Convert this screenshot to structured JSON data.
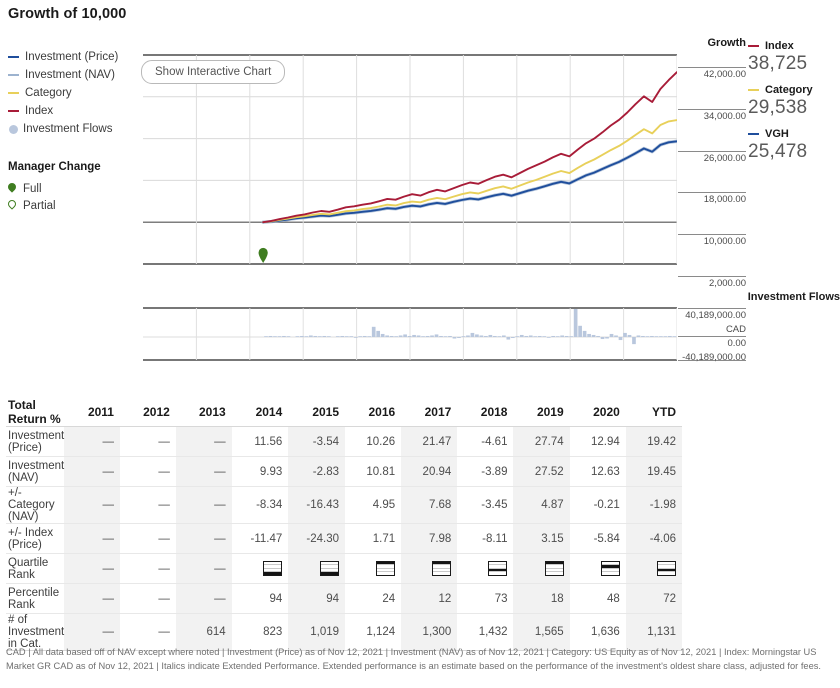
{
  "header": {
    "title": "Growth of 10,000"
  },
  "legend": {
    "items": [
      {
        "label": "Investment (Price)",
        "color": "#1f4e9c",
        "marker": "line"
      },
      {
        "label": "Investment (NAV)",
        "color": "#9db3cf",
        "marker": "line"
      },
      {
        "label": "Category",
        "color": "#e8d05a",
        "marker": "line"
      },
      {
        "label": "Index",
        "color": "#a81c38",
        "marker": "line"
      },
      {
        "label": "Investment Flows",
        "color": "#b9c7dd",
        "marker": "dot"
      }
    ],
    "manager_change": {
      "title": "Manager Change",
      "items": [
        {
          "label": "Full",
          "type": "full",
          "color": "#3f7d20"
        },
        {
          "label": "Partial",
          "type": "partial",
          "color": "#3f7d20"
        }
      ]
    }
  },
  "chart_controls": {
    "show_interactive_label": "Show Interactive Chart"
  },
  "readouts": [
    {
      "name": "Index",
      "value": "38,725",
      "color": "#a81c38"
    },
    {
      "name": "Category",
      "value": "29,538",
      "color": "#e8d05a"
    },
    {
      "name": "VGH",
      "value": "25,478",
      "color": "#1f4e9c"
    }
  ],
  "flows_axis": {
    "title": "Investment Flows",
    "ticks": [
      "40,189,000.00",
      "CAD",
      "0.00",
      "-40,189,000.00"
    ]
  },
  "table": {
    "title": "Total Return %",
    "columns": [
      "2011",
      "2012",
      "2013",
      "2014",
      "2015",
      "2016",
      "2017",
      "2018",
      "2019",
      "2020",
      "YTD"
    ],
    "shaded_columns": [
      0,
      2,
      4,
      6,
      8,
      10
    ],
    "rows": [
      {
        "label": "Investment (Price)",
        "type": "text",
        "values": [
          "—",
          "—",
          "—",
          "11.56",
          "-3.54",
          "10.26",
          "21.47",
          "-4.61",
          "27.74",
          "12.94",
          "19.42"
        ]
      },
      {
        "label": "Investment (NAV)",
        "type": "text",
        "values": [
          "—",
          "—",
          "—",
          "9.93",
          "-2.83",
          "10.81",
          "20.94",
          "-3.89",
          "27.52",
          "12.63",
          "19.45"
        ]
      },
      {
        "label": "+/- Category (NAV)",
        "type": "text",
        "values": [
          "—",
          "—",
          "—",
          "-8.34",
          "-16.43",
          "4.95",
          "7.68",
          "-3.45",
          "4.87",
          "-0.21",
          "-1.98"
        ]
      },
      {
        "label": "+/- Index (Price)",
        "type": "text",
        "values": [
          "—",
          "—",
          "—",
          "-11.47",
          "-24.30",
          "1.71",
          "7.98",
          "-8.11",
          "3.15",
          "-5.84",
          "-4.06"
        ]
      },
      {
        "label": "Quartile Rank",
        "type": "quartile",
        "values": [
          "—",
          "—",
          "—",
          4,
          4,
          1,
          1,
          3,
          1,
          2,
          3
        ]
      },
      {
        "label": "Percentile Rank",
        "type": "text",
        "values": [
          "—",
          "—",
          "—",
          "94",
          "94",
          "24",
          "12",
          "73",
          "18",
          "48",
          "72"
        ]
      },
      {
        "label": "# of Investment in Cat.",
        "type": "text",
        "values": [
          "—",
          "—",
          "614",
          "823",
          "1,019",
          "1,124",
          "1,300",
          "1,432",
          "1,565",
          "1,636",
          "1,131"
        ]
      }
    ]
  },
  "footnote": {
    "text": "CAD | All data based off of NAV except where noted | Investment (Price) as of Nov 12, 2021 | Investment (NAV) as of Nov 12, 2021 | Category: US Equity as of Nov 12, 2021 | Index: Morningstar US Market GR CAD as of Nov 12, 2021 | Italics indicate Extended Performance. Extended performance is an estimate based on the performance of the investment's oldest share class, adjusted for fees."
  },
  "chart_data": {
    "type": "line",
    "title": "Growth of 10,000",
    "ylabel": "Growth",
    "xlabel": "",
    "ylim": [
      2000,
      42000
    ],
    "yticks": [
      42000,
      34000,
      26000,
      18000,
      10000,
      2000
    ],
    "ytick_labels": [
      "42,000.00",
      "34,000.00",
      "26,000.00",
      "18,000.00",
      "10,000.00",
      "2,000.00"
    ],
    "grid": true,
    "legend_position": "left",
    "x": [
      "2011",
      "2012",
      "2013",
      "2014",
      "2015",
      "2016",
      "2017",
      "2018",
      "2019",
      "2020",
      "2021"
    ],
    "series": [
      {
        "name": "Index",
        "color": "#a81c38",
        "final_value": 38725,
        "values": [
          null,
          null,
          10000,
          11300,
          11900,
          13300,
          15800,
          15400,
          19000,
          23600,
          38725
        ],
        "monthly": [
          10000,
          10250,
          10600,
          10900,
          11250,
          11500,
          11850,
          12150,
          12000,
          12400,
          12850,
          13050,
          13350,
          13600,
          14000,
          14450,
          14300,
          14900,
          15350,
          15100,
          15750,
          16200,
          15900,
          16500,
          17100,
          17600,
          17350,
          18050,
          18700,
          19100,
          18600,
          19400,
          20200,
          20900,
          21600,
          22400,
          23100,
          22600,
          23900,
          25100,
          26000,
          27200,
          28500,
          29600,
          31000,
          32600,
          34100,
          33000,
          35500,
          37200,
          38725
        ]
      },
      {
        "name": "Category",
        "color": "#e8d05a",
        "final_value": 29538,
        "values": [
          null,
          null,
          10000,
          11000,
          11400,
          12400,
          14100,
          13600,
          16200,
          19400,
          29538
        ],
        "monthly": [
          10000,
          10180,
          10450,
          10700,
          10950,
          11150,
          11400,
          11600,
          11500,
          11800,
          12100,
          12250,
          12500,
          12700,
          13000,
          13350,
          13200,
          13650,
          13950,
          13800,
          14300,
          14650,
          14400,
          14900,
          15350,
          15700,
          15500,
          16000,
          16500,
          16850,
          16400,
          17000,
          17600,
          18100,
          18700,
          19300,
          19800,
          19400,
          20400,
          21300,
          22000,
          22900,
          23800,
          24600,
          25600,
          26700,
          27800,
          27000,
          28600,
          29300,
          29538
        ]
      },
      {
        "name": "VGH",
        "color": "#1f4e9c",
        "final_value": 25478,
        "values": [
          null,
          null,
          10000,
          10700,
          10900,
          11700,
          13200,
          12700,
          15000,
          17500,
          25478
        ],
        "monthly": [
          10000,
          10120,
          10330,
          10520,
          10740,
          10900,
          11100,
          11270,
          11180,
          11420,
          11680,
          11800,
          12000,
          12160,
          12400,
          12680,
          12560,
          12920,
          13150,
          13030,
          13430,
          13700,
          13500,
          13900,
          14250,
          14520,
          14360,
          14760,
          15150,
          15430,
          15080,
          15550,
          16020,
          16420,
          16880,
          17340,
          17740,
          17420,
          18220,
          18950,
          19500,
          20200,
          20900,
          21550,
          22350,
          23200,
          24100,
          23500,
          24800,
          25300,
          25478
        ]
      }
    ],
    "manager_change_markers": [
      {
        "type": "full",
        "x_fraction": 0.225
      }
    ]
  },
  "flows_chart_data": {
    "type": "bar",
    "title": "Investment Flows",
    "ylim": [
      -40189000,
      40189000
    ],
    "yticks": [
      40189000,
      0,
      -40189000
    ],
    "ytick_labels": [
      "40,189,000.00",
      "0.00",
      "-40,189,000.00"
    ],
    "currency": "CAD",
    "color": "#b9c7dd",
    "values": [
      0,
      0,
      0,
      0,
      0,
      0,
      0,
      0,
      0,
      0,
      0,
      0,
      0,
      0,
      0,
      0,
      0,
      0,
      0,
      0,
      0,
      0,
      0,
      0,
      0,
      0,
      0,
      1,
      2,
      1,
      1,
      2,
      1,
      0,
      1,
      2,
      1,
      3,
      2,
      1,
      2,
      1,
      0,
      1,
      2,
      1,
      1,
      -1,
      1,
      2,
      1,
      20,
      12,
      6,
      3,
      2,
      1,
      3,
      5,
      2,
      4,
      3,
      1,
      2,
      3,
      5,
      2,
      1,
      2,
      -3,
      -2,
      1,
      3,
      8,
      5,
      3,
      2,
      4,
      2,
      1,
      3,
      -5,
      -2,
      1,
      4,
      2,
      3,
      1,
      2,
      1,
      -1,
      2,
      1,
      3,
      2,
      1,
      55,
      22,
      12,
      6,
      4,
      2,
      -4,
      -3,
      6,
      3,
      -6,
      8,
      4,
      -14,
      3,
      2,
      1,
      2,
      1,
      1,
      1,
      2,
      1
    ]
  }
}
